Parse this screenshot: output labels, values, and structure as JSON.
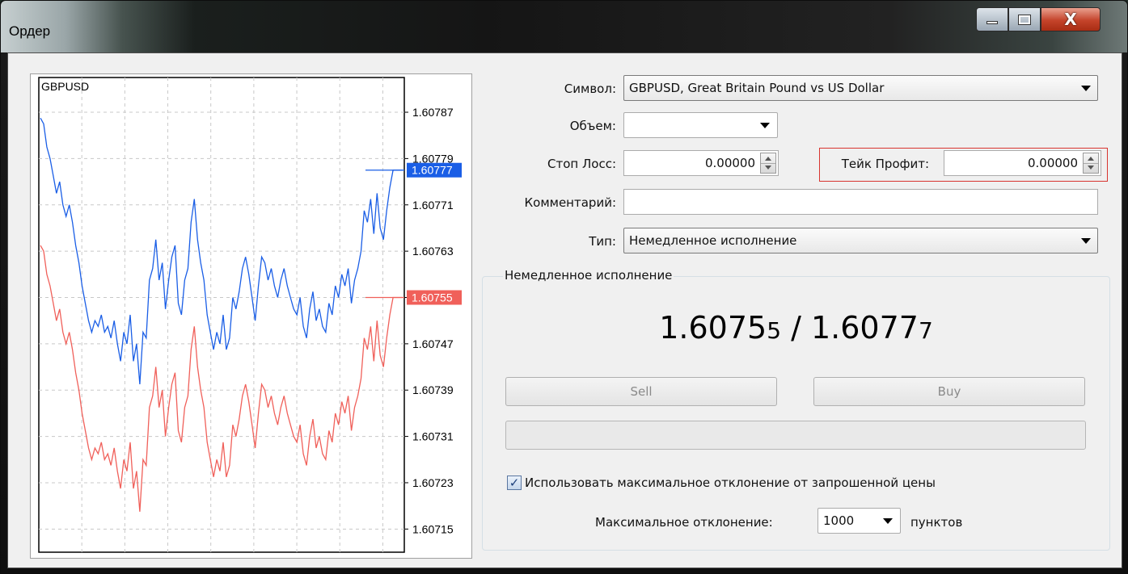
{
  "window": {
    "title": "Ордер",
    "minimize_icon": "minimize-icon",
    "maximize_icon": "maximize-icon",
    "close_icon": "close-icon",
    "close_glyph": "X"
  },
  "chart_data": {
    "type": "line",
    "title": "GBPUSD",
    "ylim": [
      1.60711,
      1.60793
    ],
    "y_ticks": [
      "1.60787",
      "1.60779",
      "1.60771",
      "1.60763",
      "1.60755",
      "1.60747",
      "1.60739",
      "1.60731",
      "1.60723",
      "1.60715"
    ],
    "grid": true,
    "series": [
      {
        "color": "#1a5ee6",
        "last_label": "1.60777",
        "values": [
          1.60786,
          1.60785,
          1.60781,
          1.60779,
          1.60776,
          1.60773,
          1.60775,
          1.60771,
          1.60769,
          1.60771,
          1.60768,
          1.60764,
          1.60761,
          1.60757,
          1.60754,
          1.60751,
          1.60749,
          1.60751,
          1.6075,
          1.60752,
          1.60749,
          1.6075,
          1.60748,
          1.60751,
          1.60747,
          1.60744,
          1.60749,
          1.60747,
          1.60752,
          1.60744,
          1.60747,
          1.6074,
          1.60749,
          1.60748,
          1.60758,
          1.6076,
          1.60765,
          1.60758,
          1.60761,
          1.60753,
          1.60758,
          1.60762,
          1.60764,
          1.60754,
          1.60752,
          1.60758,
          1.6076,
          1.60768,
          1.60772,
          1.60765,
          1.60761,
          1.60758,
          1.60752,
          1.60749,
          1.60746,
          1.60749,
          1.60747,
          1.60752,
          1.60746,
          1.60748,
          1.60755,
          1.60753,
          1.60756,
          1.6076,
          1.60762,
          1.60759,
          1.60755,
          1.60751,
          1.60757,
          1.60762,
          1.60761,
          1.60758,
          1.6076,
          1.60757,
          1.60755,
          1.60758,
          1.6076,
          1.60757,
          1.60755,
          1.60753,
          1.60752,
          1.60755,
          1.6075,
          1.60748,
          1.60753,
          1.60756,
          1.60751,
          1.60753,
          1.6075,
          1.60749,
          1.60754,
          1.60752,
          1.60757,
          1.60755,
          1.60759,
          1.60757,
          1.6076,
          1.60754,
          1.60758,
          1.6076,
          1.60763,
          1.6077,
          1.60768,
          1.60772,
          1.60766,
          1.60773,
          1.60767,
          1.60765,
          1.6077,
          1.60774,
          1.60777,
          1.60777,
          1.60777,
          1.60777
        ]
      },
      {
        "color": "#f0605a",
        "last_label": "1.60755",
        "values": [
          1.60764,
          1.60763,
          1.60759,
          1.60757,
          1.60754,
          1.60751,
          1.60753,
          1.60749,
          1.60747,
          1.60749,
          1.60746,
          1.60742,
          1.60739,
          1.60735,
          1.60732,
          1.60729,
          1.60727,
          1.60729,
          1.60728,
          1.6073,
          1.60727,
          1.60728,
          1.60726,
          1.60729,
          1.60725,
          1.60722,
          1.60727,
          1.60725,
          1.6073,
          1.60722,
          1.60725,
          1.60718,
          1.60727,
          1.60726,
          1.60736,
          1.60738,
          1.60743,
          1.60736,
          1.60739,
          1.60731,
          1.60736,
          1.6074,
          1.60742,
          1.60732,
          1.6073,
          1.60736,
          1.60738,
          1.60746,
          1.6075,
          1.60743,
          1.60739,
          1.60736,
          1.6073,
          1.60727,
          1.60724,
          1.60727,
          1.60725,
          1.6073,
          1.60724,
          1.60726,
          1.60733,
          1.60731,
          1.60734,
          1.60738,
          1.6074,
          1.60737,
          1.60733,
          1.60729,
          1.60735,
          1.6074,
          1.60739,
          1.60736,
          1.60738,
          1.60735,
          1.60733,
          1.60736,
          1.60738,
          1.60735,
          1.60733,
          1.60731,
          1.6073,
          1.60733,
          1.60728,
          1.60726,
          1.60731,
          1.60734,
          1.60729,
          1.60731,
          1.60728,
          1.60727,
          1.60732,
          1.6073,
          1.60735,
          1.60733,
          1.60737,
          1.60735,
          1.60738,
          1.60732,
          1.60736,
          1.60738,
          1.60741,
          1.60748,
          1.60746,
          1.6075,
          1.60744,
          1.60751,
          1.60745,
          1.60743,
          1.60748,
          1.60752,
          1.60755,
          1.60755,
          1.60755,
          1.60755
        ]
      }
    ]
  },
  "form": {
    "symbol_label": "Символ:",
    "symbol_value": "GBPUSD, Great Britain Pound vs US Dollar",
    "volume_label": "Объем:",
    "volume_value": "",
    "sl_label": "Стоп Лосс:",
    "sl_value": "0.00000",
    "tp_label": "Тейк Профит:",
    "tp_value": "0.00000",
    "comment_label": "Комментарий:",
    "comment_value": "",
    "type_label": "Тип:",
    "type_value": "Немедленное исполнение"
  },
  "execution": {
    "group_title": "Немедленное исполнение",
    "bid_main": "1.6075",
    "bid_small": "5",
    "separator": " / ",
    "ask_main": "1.6077",
    "ask_small": "7",
    "sell_label": "Sell",
    "buy_label": "Buy",
    "deviation_checkbox_label": "Использовать максимальное отклонение от запрошенной цены",
    "deviation_checked": true,
    "deviation_checkmark": "✓",
    "max_deviation_label": "Максимальное отклонение:",
    "max_deviation_value": "1000",
    "deviation_units": "пунктов"
  }
}
